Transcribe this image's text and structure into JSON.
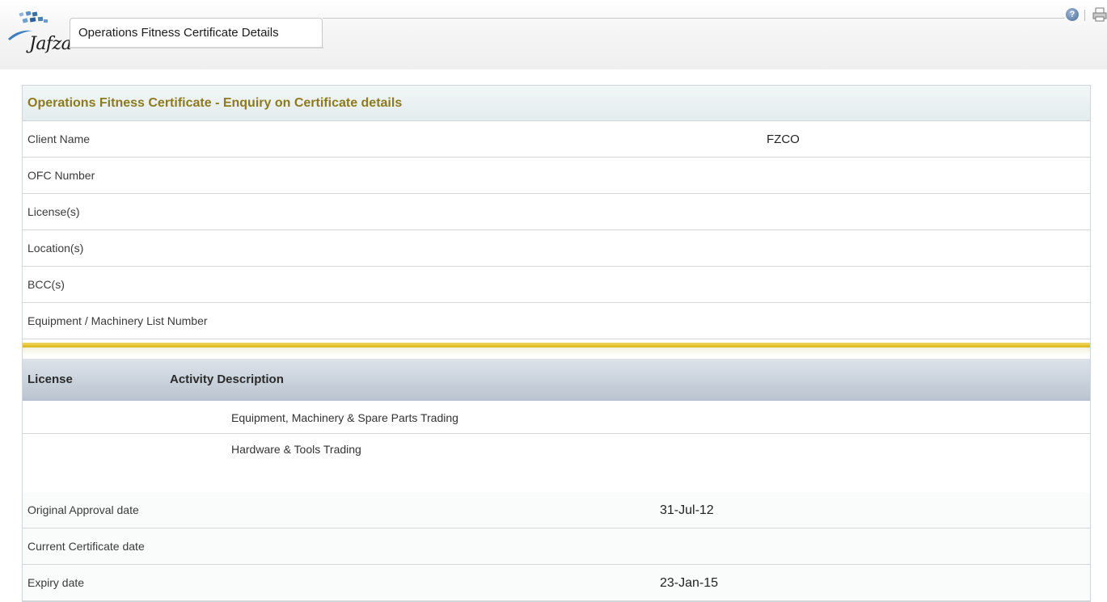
{
  "header": {
    "logo_text": "Jafza",
    "tab_title": "Operations Fitness Certificate Details",
    "help_icon": "help-icon",
    "print_icon": "print-icon"
  },
  "panel": {
    "title": "Operations Fitness Certificate - Enquiry on Certificate details",
    "fields": [
      {
        "label": "Client Name",
        "value": "FZCO"
      },
      {
        "label": "OFC Number",
        "value": ""
      },
      {
        "label": "License(s)",
        "value": ""
      },
      {
        "label": "Location(s)",
        "value": ""
      },
      {
        "label": "BCC(s)",
        "value": ""
      },
      {
        "label": "Equipment / Machinery List Number",
        "value": ""
      }
    ],
    "licenses_table": {
      "columns": [
        "License",
        "Activity Description"
      ],
      "rows": [
        {
          "license": "",
          "activity": "Equipment, Machinery & Spare Parts Trading"
        },
        {
          "license": "",
          "activity": "Hardware & Tools Trading"
        }
      ]
    },
    "dates": [
      {
        "label": "Original Approval date",
        "value": "31-Jul-12"
      },
      {
        "label": "Current Certificate date",
        "value": ""
      },
      {
        "label": "Expiry date",
        "value": "23-Jan-15"
      }
    ]
  },
  "colors": {
    "title_gold": "#8c7a1e",
    "separator_gold": "#d8b512",
    "table_header": "#b9c3cf"
  }
}
